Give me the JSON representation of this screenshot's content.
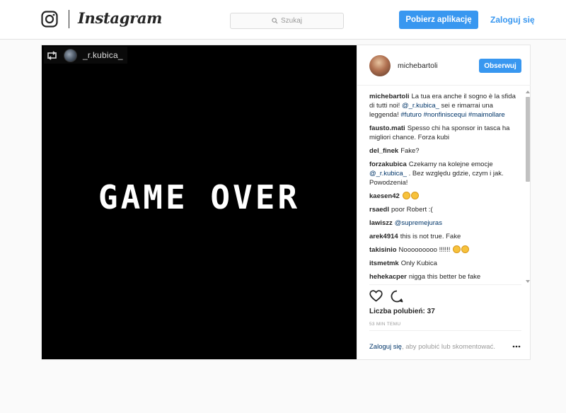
{
  "header": {
    "wordmark": "Instagram",
    "search_placeholder": "Szukaj",
    "get_app_label": "Pobierz aplikację",
    "login_label": "Zaloguj się"
  },
  "media": {
    "repost_user": "_r.kubica_",
    "image_text": "GAME OVER"
  },
  "post": {
    "author": "michebartoli",
    "follow_label": "Obserwuj",
    "comments": [
      {
        "user": "michebartoli",
        "text": "La tua era anche il sogno è la sfida di tutti noi! ",
        "mention": "@_r.kubica_",
        "after": " sei e rimarrai una leggenda! ",
        "tags": "#futuro #nonfiniscequi #maimollare"
      },
      {
        "user": "fausto.mati",
        "text": "Spesso chi ha sponsor in tasca ha migliori chance. Forza kubi"
      },
      {
        "user": "del_finek",
        "text": "Fake?"
      },
      {
        "user": "forzakubica",
        "text": "Czekamy na kolejne emocje ",
        "mention": "@_r.kubica_",
        "after": " . Bez względu gdzie, czym i jak. Powodzenia!"
      },
      {
        "user": "kaesen42",
        "text": "",
        "emoji_count": 2
      },
      {
        "user": "rsaedl",
        "text": "poor Robert :("
      },
      {
        "user": "lawiszz",
        "text": "",
        "mention": "@supremejuras"
      },
      {
        "user": "arek4914",
        "text": "this is not true. Fake"
      },
      {
        "user": "takisinio",
        "text": "Nooooooooo !!!!!! ",
        "emoji_count": 2
      },
      {
        "user": "itsmetmk",
        "text": "Only Kubica"
      },
      {
        "user": "hehekacper",
        "text": "nigga this better be fake"
      }
    ],
    "likes_label": "Liczba polubień: 37",
    "time_label": "53 MIN TEMU",
    "footer_login": "Zaloguj się",
    "footer_text": ", aby polubić lub skomentować."
  },
  "colors": {
    "accent": "#3897f0",
    "link": "#003569"
  },
  "icons": {
    "logo": "instagram-camera-icon",
    "search": "search-icon",
    "repost": "repost-icon",
    "like": "heart-icon",
    "comment": "comment-icon",
    "more": "more-icon"
  }
}
